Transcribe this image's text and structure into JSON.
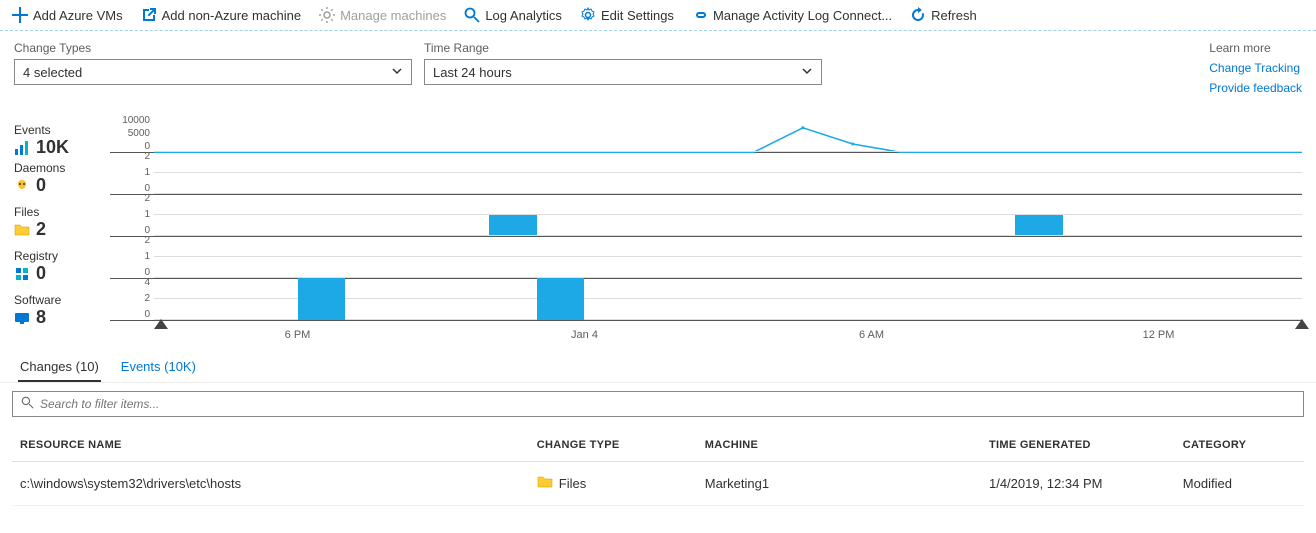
{
  "toolbar": {
    "add_vms": "Add Azure VMs",
    "add_non_azure": "Add non-Azure machine",
    "manage_machines": "Manage machines",
    "log_analytics": "Log Analytics",
    "edit_settings": "Edit Settings",
    "manage_activity": "Manage Activity Log Connect...",
    "refresh": "Refresh"
  },
  "filters": {
    "change_types_label": "Change Types",
    "change_types_value": "4 selected",
    "time_range_label": "Time Range",
    "time_range_value": "Last 24 hours"
  },
  "learn_more": {
    "title": "Learn more",
    "link1": "Change Tracking",
    "link2": "Provide feedback"
  },
  "summary": {
    "events_label": "Events",
    "events_value": "10K",
    "daemons_label": "Daemons",
    "daemons_value": "0",
    "files_label": "Files",
    "files_value": "2",
    "registry_label": "Registry",
    "registry_value": "0",
    "software_label": "Software",
    "software_value": "8"
  },
  "tabs": {
    "changes": "Changes (10)",
    "events": "Events (10K)"
  },
  "search": {
    "placeholder": "Search to filter items..."
  },
  "table": {
    "headers": {
      "resource_name": "RESOURCE NAME",
      "change_type": "CHANGE TYPE",
      "machine": "MACHINE",
      "time_generated": "TIME GENERATED",
      "category": "CATEGORY"
    },
    "rows": [
      {
        "resource_name": "c:\\windows\\system32\\drivers\\etc\\hosts",
        "change_type": "Files",
        "machine": "Marketing1",
        "time_generated": "1/4/2019, 12:34 PM",
        "category": "Modified"
      }
    ]
  },
  "chart_data": [
    {
      "type": "line",
      "title": "Events",
      "ylabel": "",
      "x": [
        0,
        1,
        2,
        3,
        4,
        5,
        6,
        7,
        8,
        9,
        10,
        11,
        12,
        13,
        14,
        15,
        16,
        17,
        18,
        19,
        20,
        21,
        22,
        23
      ],
      "y": [
        100,
        100,
        100,
        100,
        100,
        100,
        100,
        100,
        100,
        100,
        100,
        100,
        100,
        7000,
        2500,
        100,
        100,
        100,
        100,
        100,
        100,
        100,
        100,
        100
      ],
      "ylim": [
        0,
        10000
      ],
      "yticks": [
        0,
        5000,
        10000
      ]
    },
    {
      "type": "bar",
      "title": "Daemons",
      "categories": [
        0,
        1,
        2,
        3,
        4,
        5,
        6,
        7,
        8,
        9,
        10,
        11,
        12,
        13,
        14,
        15,
        16,
        17,
        18,
        19,
        20,
        21,
        22,
        23
      ],
      "values": [
        0,
        0,
        0,
        0,
        0,
        0,
        0,
        0,
        0,
        0,
        0,
        0,
        0,
        0,
        0,
        0,
        0,
        0,
        0,
        0,
        0,
        0,
        0,
        0
      ],
      "ylim": [
        0,
        2
      ],
      "yticks": [
        0,
        1,
        2
      ]
    },
    {
      "type": "bar",
      "title": "Files",
      "categories": [
        0,
        1,
        2,
        3,
        4,
        5,
        6,
        7,
        8,
        9,
        10,
        11,
        12,
        13,
        14,
        15,
        16,
        17,
        18,
        19,
        20,
        21,
        22,
        23
      ],
      "values": [
        0,
        0,
        0,
        0,
        0,
        0,
        0,
        1,
        0,
        0,
        0,
        0,
        0,
        0,
        0,
        0,
        0,
        0,
        1,
        0,
        0,
        0,
        0,
        0
      ],
      "ylim": [
        0,
        2
      ],
      "yticks": [
        0,
        1,
        2
      ]
    },
    {
      "type": "bar",
      "title": "Registry",
      "categories": [
        0,
        1,
        2,
        3,
        4,
        5,
        6,
        7,
        8,
        9,
        10,
        11,
        12,
        13,
        14,
        15,
        16,
        17,
        18,
        19,
        20,
        21,
        22,
        23
      ],
      "values": [
        0,
        0,
        0,
        0,
        0,
        0,
        0,
        0,
        0,
        0,
        0,
        0,
        0,
        0,
        0,
        0,
        0,
        0,
        0,
        0,
        0,
        0,
        0,
        0
      ],
      "ylim": [
        0,
        2
      ],
      "yticks": [
        0,
        1,
        2
      ]
    },
    {
      "type": "bar",
      "title": "Software",
      "categories": [
        0,
        1,
        2,
        3,
        4,
        5,
        6,
        7,
        8,
        9,
        10,
        11,
        12,
        13,
        14,
        15,
        16,
        17,
        18,
        19,
        20,
        21,
        22,
        23
      ],
      "values": [
        0,
        0,
        0,
        4,
        0,
        0,
        0,
        0,
        4,
        0,
        0,
        0,
        0,
        0,
        0,
        0,
        0,
        0,
        0,
        0,
        0,
        0,
        0,
        0
      ],
      "ylim": [
        0,
        4
      ],
      "yticks": [
        0,
        2,
        4
      ]
    }
  ],
  "xaxis_ticks": [
    "6 PM",
    "Jan 4",
    "6 AM",
    "12 PM"
  ]
}
